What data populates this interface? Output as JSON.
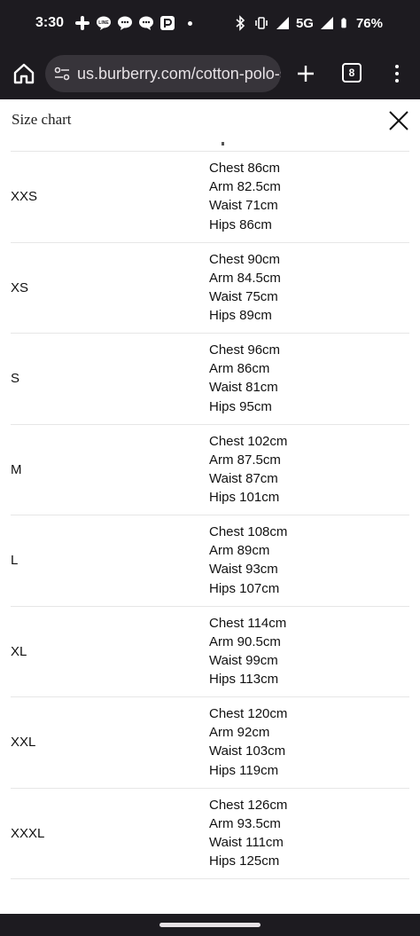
{
  "status_bar": {
    "time": "3:30",
    "network": "5G",
    "battery": "76%",
    "left_icons": [
      "slack-icon",
      "line-icon",
      "chat-bubble-icon",
      "chat-bubble-icon",
      "paypay-icon"
    ],
    "right_icons": [
      "bluetooth-icon",
      "vibrate-icon",
      "signal-icon",
      "signal-icon",
      "battery-icon"
    ]
  },
  "browser": {
    "url": "us.burberry.com/cotton-polo-s",
    "tab_count": "8"
  },
  "size_chart": {
    "title": "Size chart",
    "rows": [
      {
        "size": "XXS",
        "chest": "Chest 86cm",
        "arm": "Arm 82.5cm",
        "waist": "Waist 71cm",
        "hips": "Hips 86cm"
      },
      {
        "size": "XS",
        "chest": "Chest 90cm",
        "arm": "Arm 84.5cm",
        "waist": "Waist 75cm",
        "hips": "Hips 89cm"
      },
      {
        "size": "S",
        "chest": "Chest 96cm",
        "arm": "Arm 86cm",
        "waist": "Waist 81cm",
        "hips": "Hips 95cm"
      },
      {
        "size": "M",
        "chest": "Chest 102cm",
        "arm": "Arm 87.5cm",
        "waist": "Waist 87cm",
        "hips": "Hips 101cm"
      },
      {
        "size": "L",
        "chest": "Chest 108cm",
        "arm": "Arm 89cm",
        "waist": "Waist 93cm",
        "hips": "Hips 107cm"
      },
      {
        "size": "XL",
        "chest": "Chest 114cm",
        "arm": "Arm 90.5cm",
        "waist": "Waist 99cm",
        "hips": "Hips 113cm"
      },
      {
        "size": "XXL",
        "chest": "Chest 120cm",
        "arm": "Arm 92cm",
        "waist": "Waist 103cm",
        "hips": "Hips 119cm"
      },
      {
        "size": "XXXL",
        "chest": "Chest 126cm",
        "arm": "Arm 93.5cm",
        "waist": "Waist 111cm",
        "hips": "Hips 125cm"
      }
    ]
  },
  "colors": {
    "system_bar": "#1d1b20",
    "url_box": "#37343a",
    "sheet_background": "#ffffff",
    "divider": "#e6e6e6",
    "text": "#111111"
  }
}
